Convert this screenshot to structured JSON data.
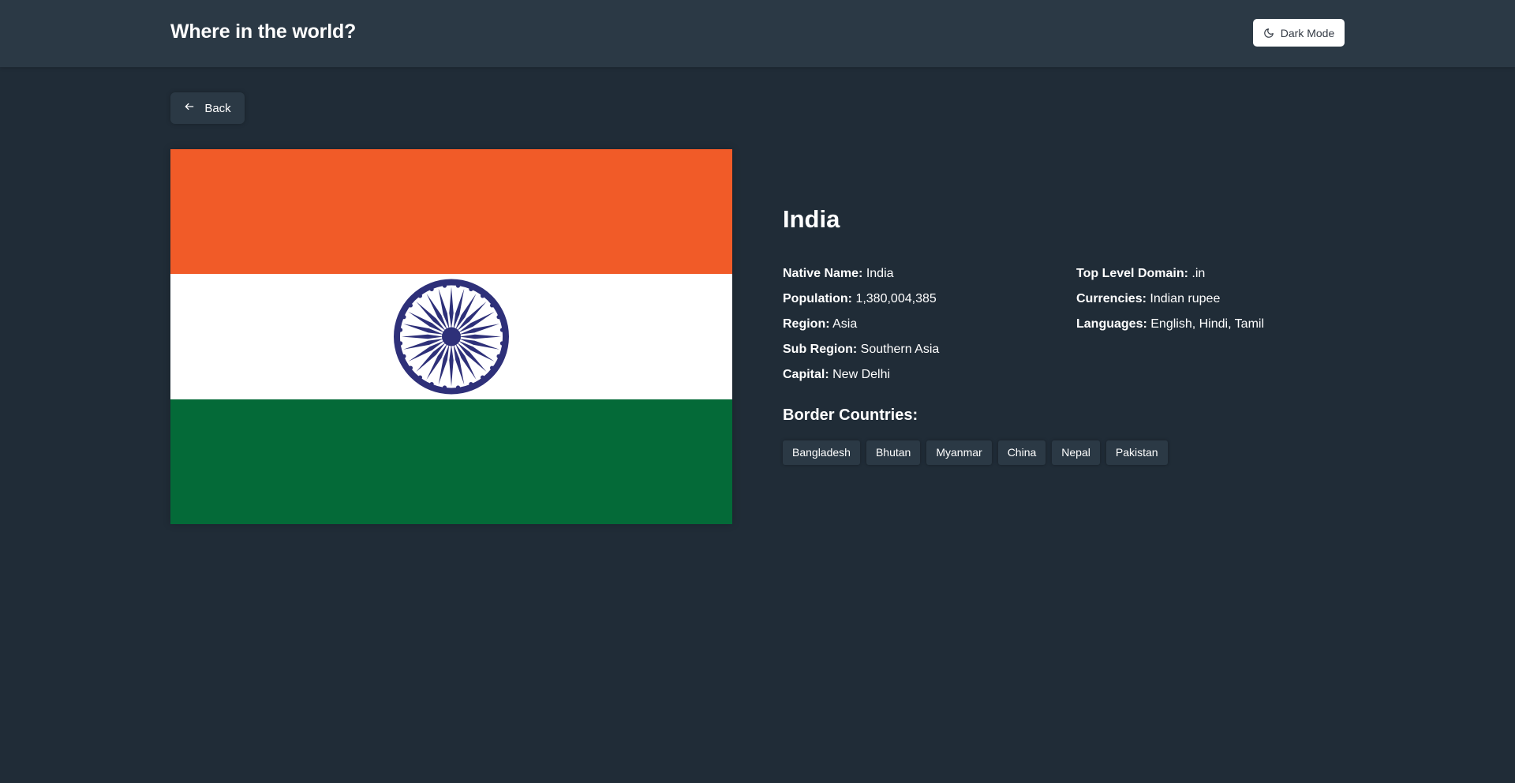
{
  "header": {
    "title": "Where in the world?",
    "theme_toggle_label": "Dark Mode",
    "theme_icon": "moon-icon"
  },
  "back_button": {
    "label": "Back",
    "icon": "arrow-left-icon"
  },
  "country": {
    "name": "India",
    "flag_icon": "flag-india",
    "flag_colors": {
      "saffron": "#F15B28",
      "white": "#FFFFFF",
      "green": "#046A38",
      "chakra": "#2E3079"
    },
    "details_left": [
      {
        "label": "Native Name:",
        "value": "India"
      },
      {
        "label": "Population:",
        "value": "1,380,004,385"
      },
      {
        "label": "Region:",
        "value": "Asia"
      },
      {
        "label": "Sub Region:",
        "value": "Southern Asia"
      },
      {
        "label": "Capital:",
        "value": "New Delhi"
      }
    ],
    "details_right": [
      {
        "label": "Top Level Domain:",
        "value": ".in"
      },
      {
        "label": "Currencies:",
        "value": "Indian rupee"
      },
      {
        "label": "Languages:",
        "value": "English, Hindi, Tamil"
      }
    ],
    "border_title": "Border Countries:",
    "border_countries": [
      "Bangladesh",
      "Bhutan",
      "Myanmar",
      "China",
      "Nepal",
      "Pakistan"
    ]
  },
  "colors": {
    "background": "#202c37",
    "element": "#2b3945",
    "text": "#ffffff"
  }
}
